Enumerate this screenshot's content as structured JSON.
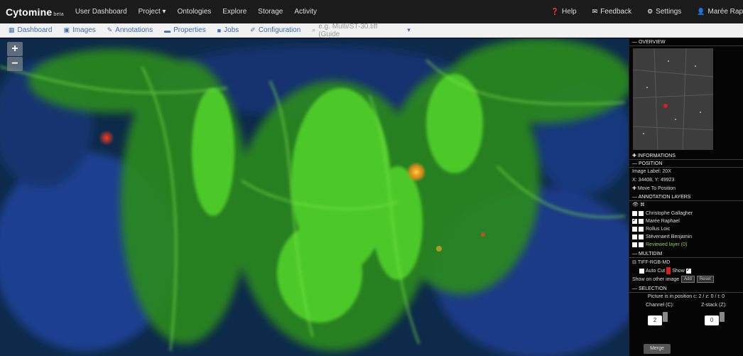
{
  "topbar": {
    "brand": "Cytomine",
    "brand_suffix": "beta",
    "nav": [
      "User Dashboard",
      "Project",
      "Ontologies",
      "Explore",
      "Storage",
      "Activity"
    ],
    "project_caret": "▾",
    "right": {
      "help": "Help",
      "feedback": "Feedback",
      "settings": "Settings",
      "user": "Marée Rap"
    }
  },
  "toolbar": {
    "dashboard": "Dashboard",
    "images": "Images",
    "annotations": "Annotations",
    "properties": "Properties",
    "jobs": "Jobs",
    "configuration": "Configuration",
    "search_placeholder": "e.g. Multi/ST-30.tiff (Guide",
    "caret": "▾"
  },
  "viewer": {
    "zoom_in": "+",
    "zoom_out": "−"
  },
  "panel": {
    "overview_title": "OVERVIEW",
    "informations_title": "INFORMATIONS",
    "position_title": "POSITION",
    "image_label": "Image Label: 20X",
    "coords": "X: 34408, Y: 49923",
    "goto": "Move To Position",
    "layers_title": "ANNOTATION LAYERS",
    "users": [
      {
        "name": "Christophe Gallagher",
        "checked": false
      },
      {
        "name": "Marée Raphael",
        "checked": true
      },
      {
        "name": "Rollus Loic",
        "checked": false
      },
      {
        "name": "Stévenaert Benjamin",
        "checked": false
      },
      {
        "name": "Reviewed layer (0)",
        "checked": false
      }
    ],
    "multi_title": "MULTIDIM",
    "multi_group": "TIFF-RGB-MD",
    "autocut": "Auto Cut",
    "show_label": "Show",
    "show_on_other": "Show on other image",
    "btn_add": "Add",
    "btn_reset": "Reset",
    "settings_title": "SELECTION",
    "picture_info": "Picture is in position c: 2 / z: 0 / t: 0",
    "channel_label": "Channel (C):",
    "zstack_label": "Z-stack (Z):",
    "channel_value": "2",
    "zstack_value": "0",
    "merge": "Merge"
  },
  "colors": {
    "navbar": "#1b1b1b",
    "toolbar": "#f1f1f1",
    "link": "#3a6fb5",
    "tissue_green": "#3ec21e",
    "tissue_blue": "#1a3a8a",
    "marker_red": "#d62020"
  }
}
